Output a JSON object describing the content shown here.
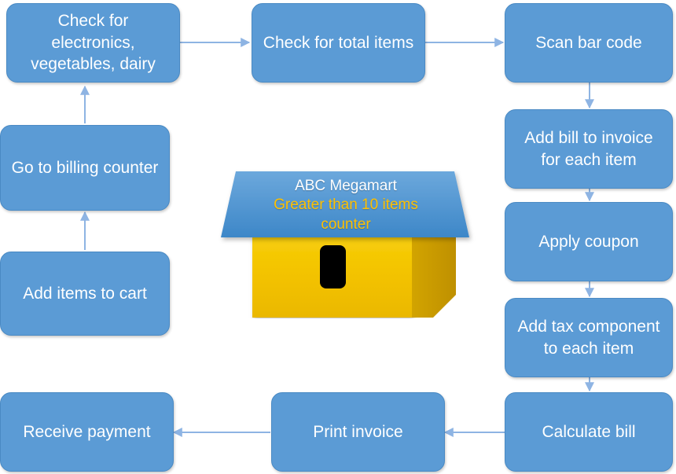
{
  "diagram": {
    "title": "ABC Megamart greater than 10 items counter process flow",
    "colors": {
      "node_fill": "#5B9BD5",
      "node_border": "#4A8AC4",
      "node_text": "#FFFFFF",
      "arrow": "#8EB4E3",
      "roof_fill": "#5B9BD5",
      "house_front": "#F5C400",
      "house_side": "#BF9000",
      "door": "#000000",
      "roof_title_text": "#FFFFFF",
      "roof_sub_text": "#FFC000",
      "background": "#FFFFFF"
    },
    "nodes": [
      {
        "id": "check-electronics",
        "label": "Check for electronics, vegetables, dairy"
      },
      {
        "id": "check-total-items",
        "label": "Check for total items"
      },
      {
        "id": "scan-bar-code",
        "label": "Scan bar code"
      },
      {
        "id": "add-bill-to-invoice",
        "label": "Add bill to invoice for each item"
      },
      {
        "id": "apply-coupon",
        "label": "Apply coupon"
      },
      {
        "id": "add-tax-component",
        "label": "Add tax component to each item"
      },
      {
        "id": "calculate-bill",
        "label": "Calculate bill"
      },
      {
        "id": "print-invoice",
        "label": "Print invoice"
      },
      {
        "id": "receive-payment",
        "label": "Receive payment"
      },
      {
        "id": "go-to-billing-counter",
        "label": "Go to billing counter"
      },
      {
        "id": "add-items-to-cart",
        "label": "Add items to cart"
      }
    ],
    "edges": [
      {
        "from": "add-items-to-cart",
        "to": "go-to-billing-counter"
      },
      {
        "from": "go-to-billing-counter",
        "to": "check-electronics"
      },
      {
        "from": "check-electronics",
        "to": "check-total-items"
      },
      {
        "from": "check-total-items",
        "to": "scan-bar-code"
      },
      {
        "from": "scan-bar-code",
        "to": "add-bill-to-invoice"
      },
      {
        "from": "add-bill-to-invoice",
        "to": "apply-coupon"
      },
      {
        "from": "apply-coupon",
        "to": "add-tax-component"
      },
      {
        "from": "add-tax-component",
        "to": "calculate-bill"
      },
      {
        "from": "calculate-bill",
        "to": "print-invoice"
      },
      {
        "from": "print-invoice",
        "to": "receive-payment"
      }
    ],
    "house": {
      "roof_title": "ABC Megamart",
      "roof_subtitle_line1": "Greater than 10 items",
      "roof_subtitle_line2": "counter"
    }
  }
}
